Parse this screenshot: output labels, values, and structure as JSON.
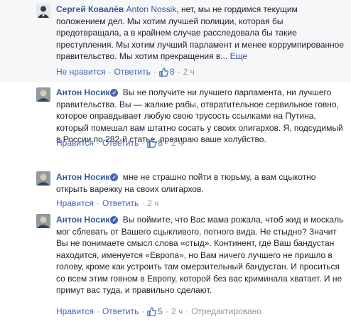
{
  "comments": [
    {
      "author": "Сергей Ковалёв",
      "verified": false,
      "tag": "Anton Nossik",
      "text": ", нет, мы не гордимся текущим положением дел. Мы хотим лучшей полиции, которая бы предотвращала, а в крайнем случае расследовала бы такие преступления. Мы хотим лучший парламент и менее коррумпированное правительство. Мы хотим прекращения в...",
      "more": "Еще",
      "like": "Не нравится",
      "reply": "Ответить",
      "likes": "8",
      "time": "2 ч"
    },
    {
      "author": "Антон Носик",
      "verified": true,
      "text": "Вы не получите ни лучшего парламента, ни лучшего правительства. Вы — жалкие рабы, отвратительное сервильное говно, которое оправдывает любую свою трусость ссылками на Путина, который помешал вам штатно сосать у своих олигархов. Я, подсудимый в России по 282-й статье, презираю ваше холуйство.",
      "like": "Нравится",
      "reply": "Ответить",
      "likes": "8",
      "time": "2 ч"
    },
    {
      "author": "Антон Носик",
      "verified": true,
      "text": "мне не страшно пойти в тюрьму, а вам сцыкотно открыть варежку на своих олигархов.",
      "like": "Нравится",
      "reply": "Ответить",
      "time": "2 ч"
    },
    {
      "author": "Антон Носик",
      "verified": true,
      "text": "Вы поймите, что Вас мама рожала, чтоб жид и москаль мог сблевать от Вашего сцыкливого, потного вида. Не стыдно? Значит Вы не понимаете смысл слова «стыд». Континент, где Ваш бандустан находится, именуется «Европа», но Вам ничего лучшего не пришло в голову, кроме как устроить там омерзительный бандустан. И проситься со всем этим говном в Европу, которой без вас криминала хватает. И не примут вас туда, и правильно сделают.",
      "like": "Нравится",
      "reply": "Ответить",
      "likes": "5",
      "time": "2 ч",
      "edited": "Отредактировано"
    }
  ],
  "colors": {
    "link": "#365899",
    "action": "#4267b2",
    "meta": "#90949c",
    "highlight_bg": "#f6f7f9"
  },
  "icons": {
    "like": "thumbs-up-icon",
    "verified": "verified-badge-icon"
  }
}
